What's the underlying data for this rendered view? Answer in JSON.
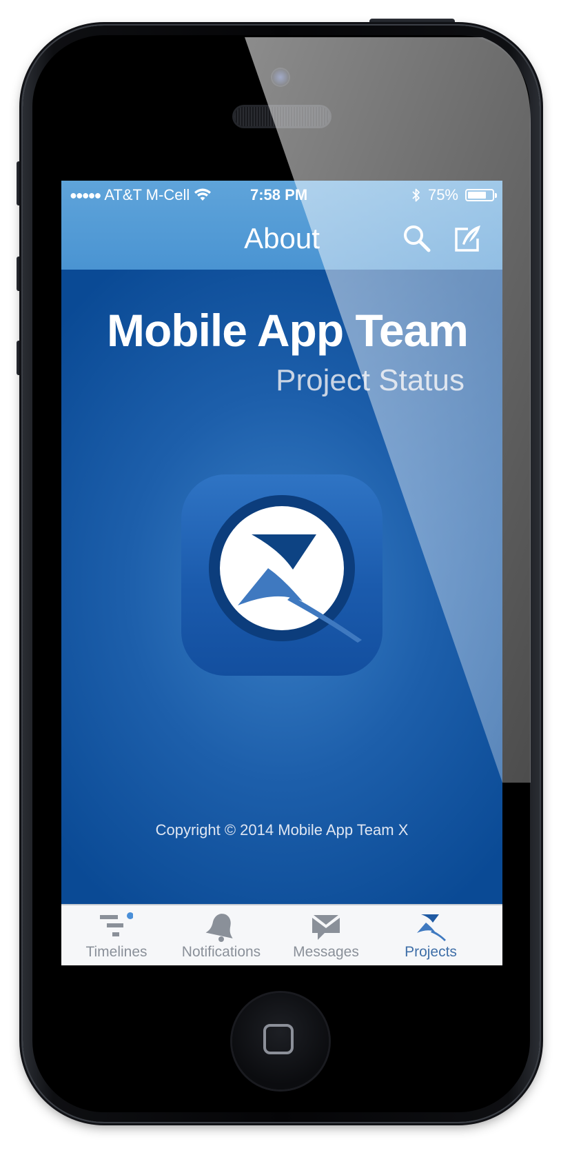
{
  "status_bar": {
    "signal_dots": "●●●●●",
    "carrier": "AT&T M-Cell",
    "time": "7:58 PM",
    "battery_percent": "75%",
    "battery_level": 0.75
  },
  "nav": {
    "title": "About",
    "search_icon": "search-icon",
    "compose_icon": "compose-icon"
  },
  "about": {
    "title": "Mobile App Team",
    "subtitle": "Project Status",
    "copyright": "Copyright © 2014 Mobile App Team X"
  },
  "tabs": [
    {
      "label": "Timelines",
      "icon": "timelines-icon",
      "active": false
    },
    {
      "label": "Notifications",
      "icon": "bell-icon",
      "active": false
    },
    {
      "label": "Messages",
      "icon": "envelope-icon",
      "active": false
    },
    {
      "label": "Projects",
      "icon": "projects-x-icon",
      "active": true
    }
  ],
  "colors": {
    "nav_bar": "#5fa4da",
    "content_background": "#0b4a95",
    "tab_inactive": "#8a9099",
    "tab_active": "#3f6fa8",
    "badge": "#4a8fd8"
  }
}
